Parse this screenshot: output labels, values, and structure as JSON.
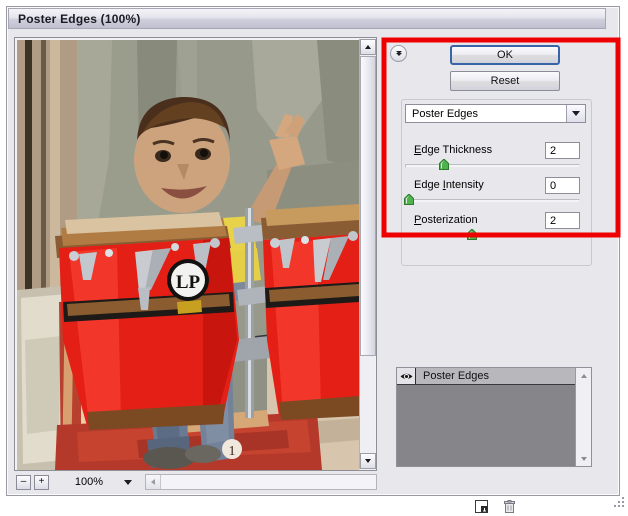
{
  "window": {
    "title": "Poster Edges (100%)"
  },
  "preview": {
    "zoom_out_label": "–",
    "zoom_in_label": "+",
    "zoom_level": "100%",
    "vscroll_up_icon": "scroll-up-arrow-icon",
    "vscroll_down_icon": "scroll-down-arrow-icon",
    "hscroll_left_icon": "scroll-left-arrow-icon",
    "zoom_dropdown_icon": "chevron-down-icon"
  },
  "panel": {
    "collapse_icon": "double-chevron-down-icon",
    "ok_label": "OK",
    "reset_label": "Reset",
    "filter_select": {
      "value": "Poster Edges",
      "arrow_icon": "chevron-down-icon"
    },
    "sliders": [
      {
        "label_pre": "",
        "label_mnemonic": "E",
        "label_post": "dge Thickness",
        "value": "2",
        "percent": 22
      },
      {
        "label_pre": "Edge ",
        "label_mnemonic": "I",
        "label_post": "ntensity",
        "value": "0",
        "percent": 2
      },
      {
        "label_pre": "",
        "label_mnemonic": "P",
        "label_post": "osterization",
        "value": "2",
        "percent": 38
      }
    ]
  },
  "effects": {
    "visibility_icon": "eye-icon",
    "items": [
      {
        "name": "Poster Edges"
      }
    ],
    "scroll_up_icon": "scroll-up-arrow-icon",
    "scroll_down_icon": "scroll-down-arrow-icon",
    "new_effect_icon": "new-effect-layer-icon",
    "delete_icon": "trash-icon"
  },
  "annotation": {
    "highlight_color": "#ee0000"
  }
}
